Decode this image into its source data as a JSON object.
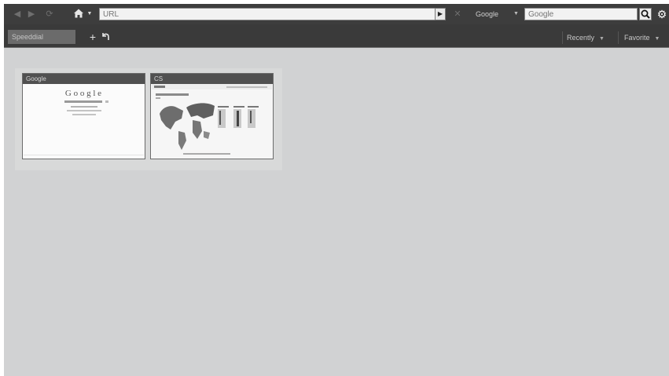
{
  "toolbar": {
    "back_icon": "back-arrow-icon",
    "forward_icon": "forward-arrow-icon",
    "reload_icon": "reload-icon",
    "home_icon": "home-icon",
    "url": {
      "value": "",
      "placeholder": "URL"
    },
    "go_icon": "play-icon",
    "stop_icon": "stop-icon",
    "search_engine": "Google",
    "search": {
      "value": "",
      "placeholder": "Google"
    },
    "search_icon": "magnifier-icon",
    "settings_icon": "gear-icon"
  },
  "tabs": [
    {
      "label": "Speeddial",
      "active": true
    }
  ],
  "tabstrip": {
    "recent_label": "Recently",
    "favorites_label": "Favorite"
  },
  "speed_dial": [
    {
      "title": "Google",
      "preview": "google-homepage-thumbnail"
    },
    {
      "title": "CS",
      "preview": "world-map-page-thumbnail"
    }
  ],
  "colors": {
    "toolbar_bg": "#3d3d3d",
    "page_bg": "#d1d2d3",
    "thumb_title_bg": "#505050"
  }
}
